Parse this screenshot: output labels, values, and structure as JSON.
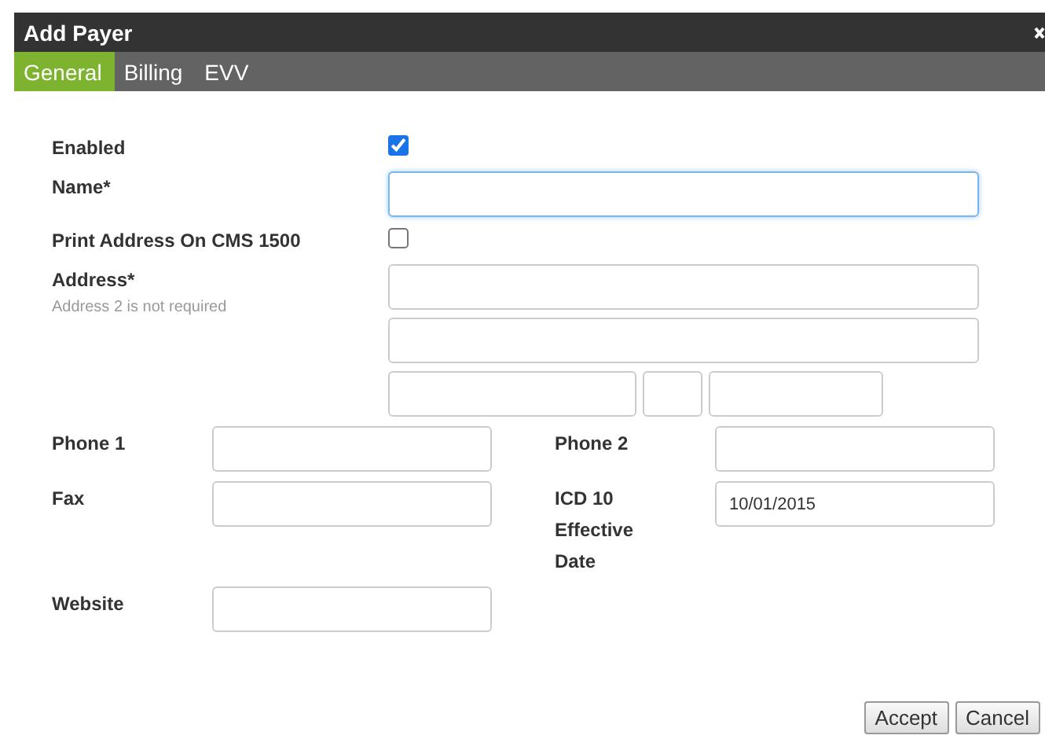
{
  "dialog": {
    "title": "Add Payer"
  },
  "tabs": [
    {
      "label": "General",
      "selected": true
    },
    {
      "label": "Billing",
      "selected": false
    },
    {
      "label": "EVV",
      "selected": false
    }
  ],
  "fields": [
    {
      "kind": "checkbox",
      "label": "Enabled",
      "checked": true
    },
    {
      "kind": "text",
      "label": "Name*",
      "focused": true
    },
    {
      "kind": "checkbox",
      "label": "Print Address On CMS 1500",
      "checked": false
    },
    {
      "kind": "address",
      "label": "Address*",
      "hint": "Address 2 is not required"
    }
  ],
  "contact_fields": [
    {
      "label": "Phone 1"
    },
    {
      "label": "Phone 2"
    },
    {
      "label": "Fax"
    },
    {
      "label": "ICD 10 Effective Date",
      "value": "10/01/2015"
    },
    {
      "label": "Website"
    }
  ],
  "buttons": [
    "Accept",
    "Cancel"
  ]
}
